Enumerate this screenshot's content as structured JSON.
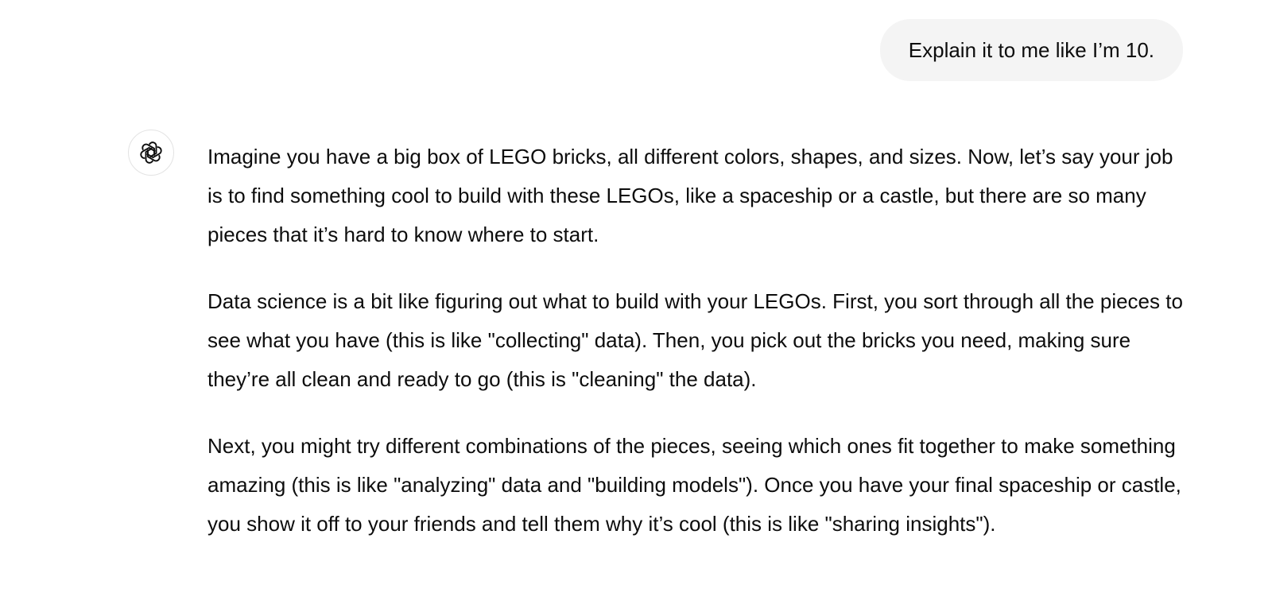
{
  "conversation": {
    "user_message": "Explain it to me like I’m 10.",
    "assistant": {
      "avatar_icon": "openai-logo-icon",
      "paragraphs": [
        "Imagine you have a big box of LEGO bricks, all different colors, shapes, and sizes. Now, let’s say your job is to find something cool to build with these LEGOs, like a spaceship or a castle, but there are so many pieces that it’s hard to know where to start.",
        "Data science is a bit like figuring out what to build with your LEGOs. First, you sort through all the pieces to see what you have (this is like \"collecting\" data). Then, you pick out the bricks you need, making sure they’re all clean and ready to go (this is \"cleaning\" the data).",
        "Next, you might try different combinations of the pieces, seeing which ones fit together to make something amazing (this is like \"analyzing\" data and \"building models\"). Once you have your final spaceship or castle, you show it off to your friends and tell them why it’s cool (this is like \"sharing insights\")."
      ]
    }
  },
  "colors": {
    "user_bubble_bg": "#f4f4f4",
    "text": "#0d0d0d",
    "avatar_border": "#e3e3e3"
  }
}
